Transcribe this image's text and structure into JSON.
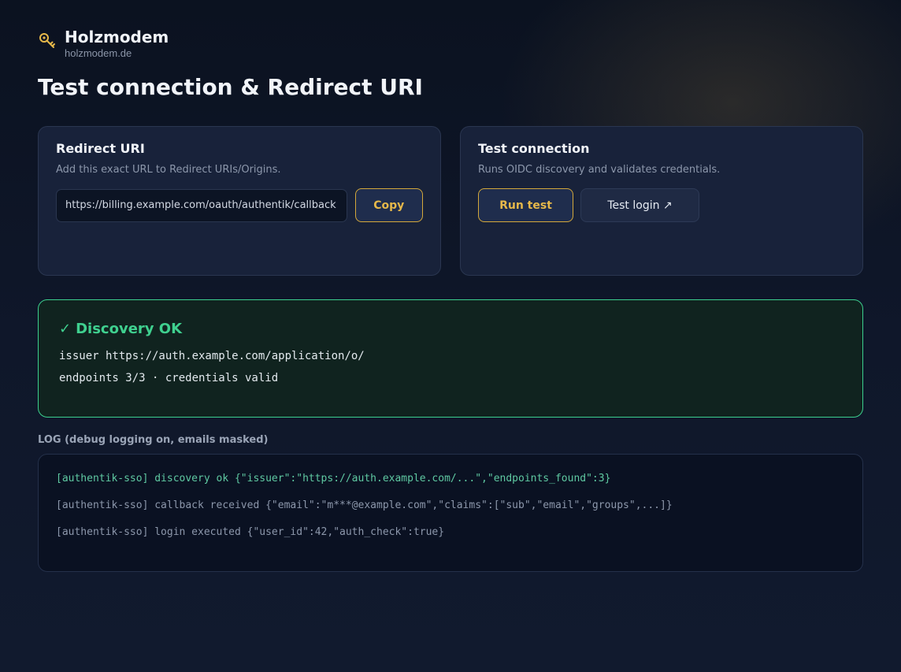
{
  "brand": {
    "name": "Holzmodem",
    "domain": "holzmodem.de",
    "icon": "key-icon",
    "accent_color": "#e6b84a"
  },
  "page": {
    "title": "Test connection & Redirect URI"
  },
  "redirect_card": {
    "title": "Redirect URI",
    "subtitle": "Add this exact URL to Redirect URIs/Origins.",
    "uri_value": "https://billing.example.com/oauth/authentik/callback",
    "copy_label": "Copy"
  },
  "test_card": {
    "title": "Test connection",
    "subtitle": "Runs OIDC discovery and validates credentials.",
    "run_label": "Run test",
    "login_label": "Test login ↗"
  },
  "result": {
    "check": "✓",
    "title": "Discovery OK",
    "lines": [
      "issuer https://auth.example.com/application/o/",
      "endpoints 3/3 · credentials valid"
    ],
    "status_color": "#3fd08f"
  },
  "log": {
    "label": "LOG (debug logging on, emails masked)",
    "entries": [
      "[authentik-sso] discovery ok {\"issuer\":\"https://auth.example.com/...\",\"endpoints_found\":3}",
      "[authentik-sso] callback received {\"email\":\"m***@example.com\",\"claims\":[\"sub\",\"email\",\"groups\",...]}",
      "[authentik-sso] login executed {\"user_id\":42,\"auth_check\":true}"
    ]
  }
}
